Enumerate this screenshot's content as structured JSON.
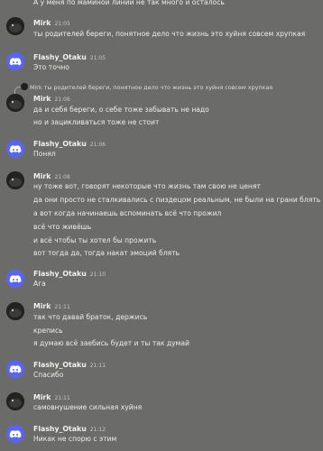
{
  "colors": {
    "background": "#6b6c69",
    "discord_blurple": "#5865f2",
    "text": "#eceee9"
  },
  "top_line": "А у меня по маминой линии не так много и осталось",
  "messages": [
    {
      "author": "Mirk",
      "time": "21:05",
      "avatar": "mirk-avatar",
      "lines": [
        "ты родителей береги, понятное дело что жизнь это хуйня совсем хрупкая"
      ]
    },
    {
      "author": "Flashy_Otaku",
      "time": "21:05",
      "avatar": "discord-logo-avatar",
      "lines": [
        "Это точно"
      ]
    },
    {
      "reply_to": {
        "author": "Mirk",
        "text": "ты родителей береги, понятное дело что жизнь это хуйня совсем хрупкая"
      },
      "author": "Mirk",
      "time": "21:06",
      "avatar": "mirk-avatar",
      "lines": [
        "да и себя береги, о себе тоже забывать не надо",
        "но и зацикливаться тоже не стоит"
      ]
    },
    {
      "author": "Flashy_Otaku",
      "time": "21:06",
      "avatar": "discord-logo-avatar",
      "lines": [
        "Понял"
      ]
    },
    {
      "author": "Mirk",
      "time": "21:08",
      "avatar": "mirk-avatar",
      "lines": [
        "ну тоже вот, говорят некоторые что жизнь там свою не ценят",
        "да они просто не сталкивались с пиздецом реальным, не были на грани блять",
        "а вот когда начинаешь вспоминать всё что прожил",
        "всё что живёшь",
        "и всё чтобы ты хотел бы прожить",
        "вот тогда да, тогда накат эмоций блять"
      ]
    },
    {
      "author": "Flashy_Otaku",
      "time": "21:10",
      "avatar": "discord-logo-avatar",
      "lines": [
        "Ага"
      ]
    },
    {
      "author": "Mirk",
      "time": "21:11",
      "avatar": "mirk-avatar",
      "lines": [
        "так что давай браток, держись",
        "крепись",
        "я думаю всё заебись будет и ты так думай"
      ]
    },
    {
      "author": "Flashy_Otaku",
      "time": "21:11",
      "avatar": "discord-logo-avatar",
      "lines": [
        "Спасибо"
      ]
    },
    {
      "author": "Mirk",
      "time": "21:11",
      "avatar": "mirk-avatar",
      "lines": [
        "самовнушение сильная хуйня"
      ]
    },
    {
      "author": "Flashy_Otaku",
      "time": "21:12",
      "avatar": "discord-logo-avatar",
      "lines": [
        "Никак не спорю с этим"
      ]
    }
  ]
}
